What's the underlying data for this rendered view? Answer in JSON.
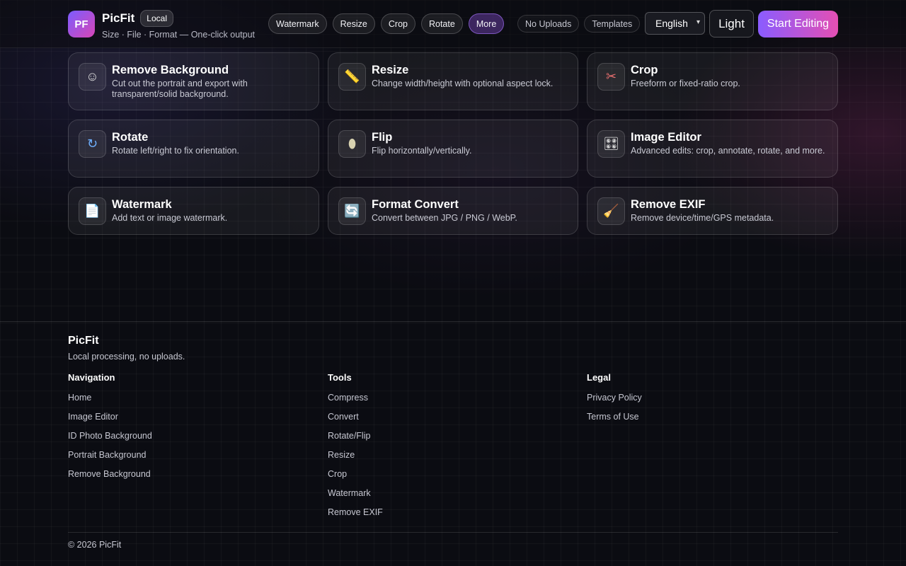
{
  "header": {
    "logo_text": "PF",
    "brand_name": "PicFit",
    "badge": "Local",
    "tagline": "Size · File · Format — One-click output",
    "nav": [
      "Watermark",
      "Resize",
      "Crop",
      "Rotate",
      "More"
    ],
    "active_nav": "More",
    "chips": [
      "No Uploads",
      "Templates"
    ],
    "language": "English",
    "theme_label": "Light",
    "start_label": "Start Editing"
  },
  "tools": [
    {
      "title": "Remove Background",
      "desc": "Cut out the portrait and export with transparent/solid background.",
      "icon": "face-outline-icon",
      "glyph": "☺"
    },
    {
      "title": "Resize",
      "desc": "Change width/height with optional aspect lock.",
      "icon": "ruler-icon",
      "glyph": "📏"
    },
    {
      "title": "Crop",
      "desc": "Freeform or fixed-ratio crop.",
      "icon": "scissors-icon",
      "glyph": "✂"
    },
    {
      "title": "Rotate",
      "desc": "Rotate left/right to fix orientation.",
      "icon": "rotate-arrow-icon",
      "glyph": "↻"
    },
    {
      "title": "Flip",
      "desc": "Flip horizontally/vertically.",
      "icon": "mirror-icon",
      "glyph": "⬮"
    },
    {
      "title": "Image Editor",
      "desc": "Advanced edits: crop, annotate, rotate, and more.",
      "icon": "control-knobs-icon",
      "glyph": "🎛"
    },
    {
      "title": "Watermark",
      "desc": "Add text or image watermark.",
      "icon": "document-icon",
      "glyph": "📄"
    },
    {
      "title": "Format Convert",
      "desc": "Convert between JPG / PNG / WebP.",
      "icon": "convert-arrows-icon",
      "glyph": "🔄"
    },
    {
      "title": "Remove EXIF",
      "desc": "Remove device/time/GPS metadata.",
      "icon": "broom-icon",
      "glyph": "🧹"
    }
  ],
  "footer": {
    "brand": "PicFit",
    "subtitle": "Local processing, no uploads.",
    "navigation_title": "Navigation",
    "navigation": [
      "Home",
      "Image Editor",
      "ID Photo Background",
      "Portrait Background",
      "Remove Background"
    ],
    "tools_title": "Tools",
    "tools": [
      "Compress",
      "Convert",
      "Rotate/Flip",
      "Resize",
      "Crop",
      "Watermark",
      "Remove EXIF"
    ],
    "legal_title": "Legal",
    "legal": [
      "Privacy Policy",
      "Terms of Use"
    ],
    "copyright": "© 2026 PicFit"
  }
}
